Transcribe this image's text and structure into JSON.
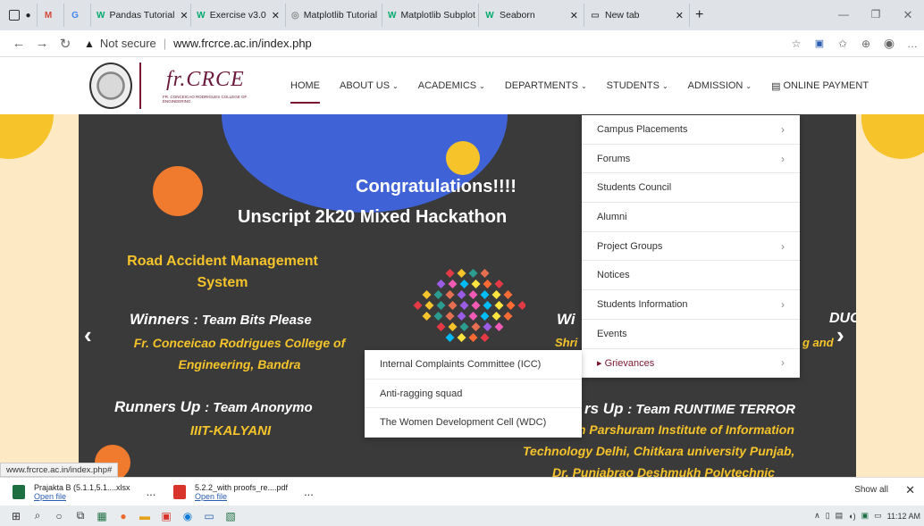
{
  "browser": {
    "tabs": [
      {
        "label": "",
        "icon": "gmail-icon",
        "glyph": "M",
        "color": "#d44638"
      },
      {
        "label": "",
        "icon": "google-icon",
        "glyph": "G",
        "color": "#4285f4"
      },
      {
        "label": "Pandas Tutorial",
        "icon": "w3schools-icon",
        "glyph": "W",
        "color": "#04aa6d"
      },
      {
        "label": "Exercise v3.0",
        "icon": "w3schools-icon",
        "glyph": "W",
        "color": "#04aa6d"
      },
      {
        "label": "Matplotlib Tutorial",
        "icon": "matplotlib-icon",
        "glyph": "◎",
        "color": "#888"
      },
      {
        "label": "Matplotlib Subplot",
        "icon": "w3schools-icon",
        "glyph": "W",
        "color": "#04aa6d"
      },
      {
        "label": "Seaborn",
        "icon": "w3schools-icon",
        "glyph": "W",
        "color": "#04aa6d"
      },
      {
        "label": "New tab",
        "icon": "newtab-icon",
        "glyph": "▭",
        "color": "#555"
      }
    ],
    "url_warning": "Not secure",
    "url": "www.frcrce.ac.in/index.php"
  },
  "site": {
    "logo_text": "fr.CRCE",
    "logo_subtext": "FR. CONCEICAO RODRIGUES COLLEGE OF ENGINEERING",
    "nav": [
      {
        "label": "HOME",
        "has_caret": false,
        "active": true
      },
      {
        "label": "ABOUT US",
        "has_caret": true
      },
      {
        "label": "ACADEMICS",
        "has_caret": true
      },
      {
        "label": "DEPARTMENTS",
        "has_caret": true
      },
      {
        "label": "STUDENTS",
        "has_caret": true
      },
      {
        "label": "ADMISSION",
        "has_caret": true
      },
      {
        "label": "ONLINE PAYMENT",
        "has_caret": false,
        "icon": "payment-card-icon"
      }
    ]
  },
  "banner": {
    "congrats": "Congratulations!!!!",
    "event": "Unscript 2k20 Mixed Hackathon",
    "project_title_1": "Road Accident Management",
    "project_title_2": "System",
    "winners_label": "Winners",
    "winners_team": ": Team Bits Please",
    "winners_college_1": "Fr. Conceicao Rodrigues College of",
    "winners_college_2": "Engineering, Bandra",
    "runners_label": "Runners Up",
    "runners_team": ": Team Anonymo",
    "runners_college": "IIIT-KALYANI",
    "right_w_fragment": "Wi",
    "right_duo_fragment": "DUO",
    "right_shri_fragment": "Shri",
    "right_and_fragment": "g and",
    "right_runners_fragment": "rs Up",
    "right_runners_team": ": Team RUNTIME TERROR",
    "right_line_1": "gh    n Parshuram Institute of Information",
    "right_line_2": "Technology Delhi, Chitkara university Punjab,",
    "right_line_3": "Dr. Punjabrao Deshmukh Polytechnic"
  },
  "students_menu": [
    {
      "label": "Campus Placements",
      "has_sub": true
    },
    {
      "label": "Forums",
      "has_sub": true
    },
    {
      "label": "Students Council",
      "has_sub": false
    },
    {
      "label": "Alumni",
      "has_sub": false
    },
    {
      "label": "Project Groups",
      "has_sub": true
    },
    {
      "label": "Notices",
      "has_sub": false
    },
    {
      "label": "Students Information",
      "has_sub": true
    },
    {
      "label": "Events",
      "has_sub": false
    },
    {
      "label": "▸ Grievances",
      "has_sub": true,
      "highlight": true
    }
  ],
  "grievances_menu": [
    {
      "label": "Internal Complaints Committee (ICC)"
    },
    {
      "label": "Anti-ragging squad"
    },
    {
      "label": "The Women Development Cell (WDC)"
    }
  ],
  "status_url": "www.frcrce.ac.in/index.php#",
  "downloads": [
    {
      "name": "Prajakta B (5.1.1,5.1....xlsx",
      "action": "Open file",
      "icon": "excel-file-icon",
      "color": "#1d6f42"
    },
    {
      "name": "5.2.2_with proofs_re....pdf",
      "action": "Open file",
      "icon": "pdf-file-icon",
      "color": "#d9342b"
    }
  ],
  "download_more": "...",
  "show_all": "Show all",
  "clock": "11:12 AM"
}
